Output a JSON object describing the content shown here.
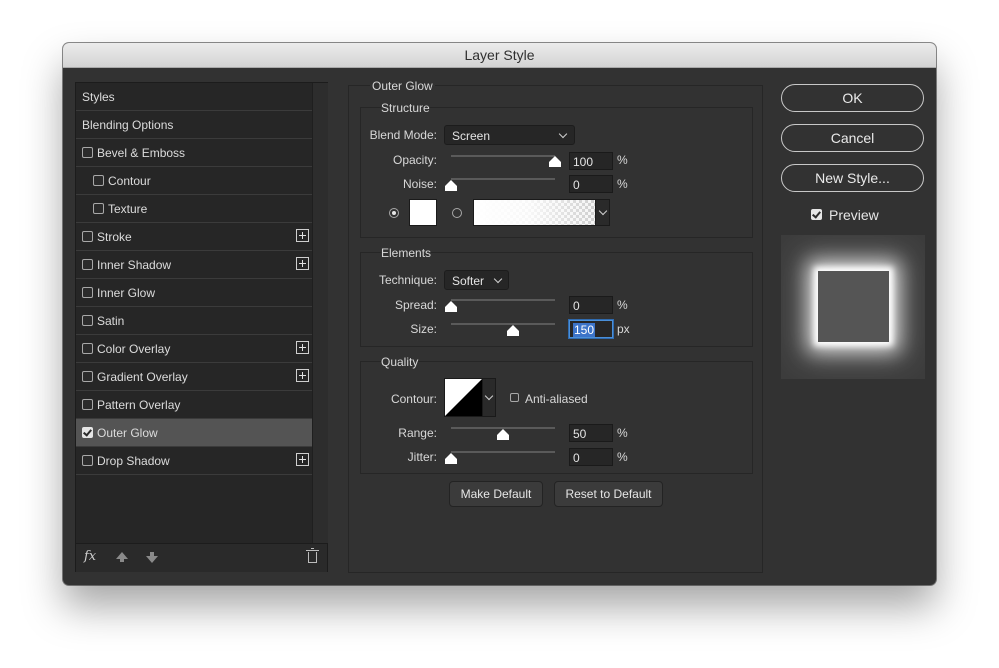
{
  "window": {
    "title": "Layer Style"
  },
  "styles_panel": {
    "items": [
      {
        "label": "Styles",
        "has_checkbox": false,
        "checked": false,
        "has_plus": false,
        "indent": 0,
        "selected": false
      },
      {
        "label": "Blending Options",
        "has_checkbox": false,
        "checked": false,
        "has_plus": false,
        "indent": 0,
        "selected": false
      },
      {
        "label": "Bevel & Emboss",
        "has_checkbox": true,
        "checked": false,
        "has_plus": false,
        "indent": 0,
        "selected": false
      },
      {
        "label": "Contour",
        "has_checkbox": true,
        "checked": false,
        "has_plus": false,
        "indent": 1,
        "selected": false
      },
      {
        "label": "Texture",
        "has_checkbox": true,
        "checked": false,
        "has_plus": false,
        "indent": 1,
        "selected": false
      },
      {
        "label": "Stroke",
        "has_checkbox": true,
        "checked": false,
        "has_plus": true,
        "indent": 0,
        "selected": false
      },
      {
        "label": "Inner Shadow",
        "has_checkbox": true,
        "checked": false,
        "has_plus": true,
        "indent": 0,
        "selected": false
      },
      {
        "label": "Inner Glow",
        "has_checkbox": true,
        "checked": false,
        "has_plus": false,
        "indent": 0,
        "selected": false
      },
      {
        "label": "Satin",
        "has_checkbox": true,
        "checked": false,
        "has_plus": false,
        "indent": 0,
        "selected": false
      },
      {
        "label": "Color Overlay",
        "has_checkbox": true,
        "checked": false,
        "has_plus": true,
        "indent": 0,
        "selected": false
      },
      {
        "label": "Gradient Overlay",
        "has_checkbox": true,
        "checked": false,
        "has_plus": true,
        "indent": 0,
        "selected": false
      },
      {
        "label": "Pattern Overlay",
        "has_checkbox": true,
        "checked": false,
        "has_plus": false,
        "indent": 0,
        "selected": false
      },
      {
        "label": "Outer Glow",
        "has_checkbox": true,
        "checked": true,
        "has_plus": false,
        "indent": 0,
        "selected": true
      },
      {
        "label": "Drop Shadow",
        "has_checkbox": true,
        "checked": false,
        "has_plus": true,
        "indent": 0,
        "selected": false
      }
    ],
    "footer": {
      "fx_label": "fx"
    }
  },
  "outer_glow": {
    "title": "Outer Glow",
    "structure": {
      "title": "Structure",
      "blend_mode_label": "Blend Mode:",
      "blend_mode_value": "Screen",
      "opacity_label": "Opacity:",
      "opacity_value": "100",
      "opacity_fraction": 1.0,
      "opacity_unit": "%",
      "noise_label": "Noise:",
      "noise_value": "0",
      "noise_fraction": 0.0,
      "noise_unit": "%",
      "color_mode": "solid"
    },
    "elements": {
      "title": "Elements",
      "technique_label": "Technique:",
      "technique_value": "Softer",
      "spread_label": "Spread:",
      "spread_value": "0",
      "spread_fraction": 0.0,
      "spread_unit": "%",
      "size_label": "Size:",
      "size_value": "150",
      "size_fraction": 0.6,
      "size_unit": "px"
    },
    "quality": {
      "title": "Quality",
      "contour_label": "Contour:",
      "anti_aliased_label": "Anti-aliased",
      "anti_aliased_checked": false,
      "range_label": "Range:",
      "range_value": "50",
      "range_fraction": 0.5,
      "range_unit": "%",
      "jitter_label": "Jitter:",
      "jitter_value": "0",
      "jitter_fraction": 0.0,
      "jitter_unit": "%"
    },
    "buttons": {
      "make_default": "Make Default",
      "reset_to_default": "Reset to Default"
    }
  },
  "actions": {
    "ok": "OK",
    "cancel": "Cancel",
    "new_style": "New Style...",
    "preview_label": "Preview",
    "preview_checked": true
  },
  "colors": {
    "dialog_bg": "#323232",
    "panel_bg": "#262626",
    "selected_row": "#545454",
    "glow_color": "#ffffff",
    "preview_square": "#555555",
    "text_selection": "#3c74c9"
  }
}
